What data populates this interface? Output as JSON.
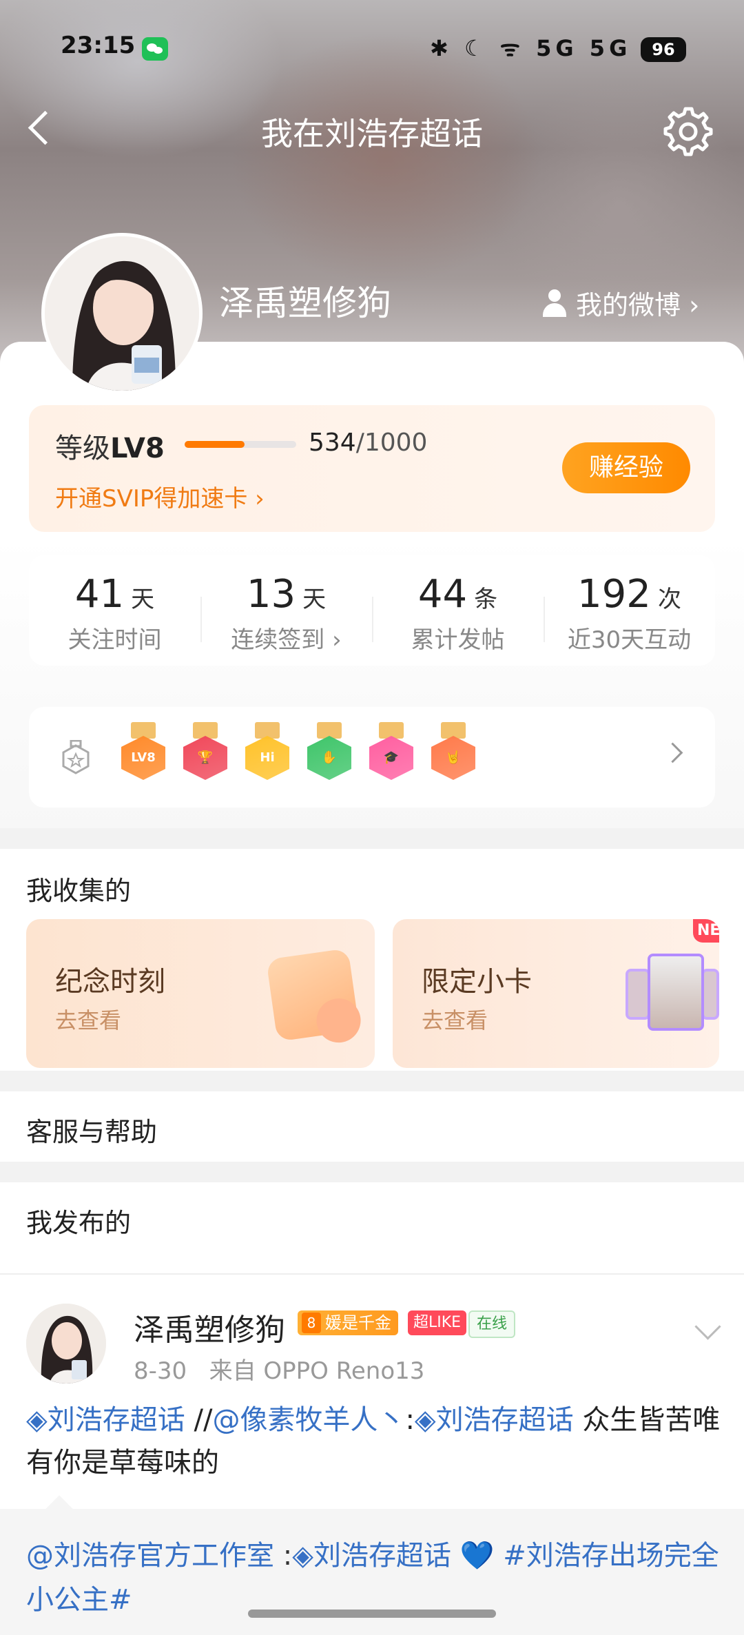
{
  "status_bar": {
    "time": "23:15",
    "battery": "96",
    "signals": "✱ ☾ ᯤ 5G 5G"
  },
  "nav": {
    "title": "我在刘浩存超话"
  },
  "profile": {
    "username": "泽禹塑修狗",
    "my_weibo": "我的微博 ›"
  },
  "level": {
    "label_prefix": "等级",
    "level": "LV8",
    "current": "534",
    "total": "/1000",
    "progress": 0.534,
    "svip_text": "开通SVIP得加速卡 ›",
    "earn_button": "赚经验"
  },
  "stats": [
    {
      "num": "41",
      "unit": "天",
      "label": "关注时间"
    },
    {
      "num": "13",
      "unit": "天",
      "label": "连续签到 ›"
    },
    {
      "num": "44",
      "unit": "条",
      "label": "累计发帖"
    },
    {
      "num": "192",
      "unit": "次",
      "label": "近30天互动"
    }
  ],
  "badges": [
    {
      "name": "lv-badge",
      "color": "#ff8a2a",
      "glyph": "LV8"
    },
    {
      "name": "trophy-badge",
      "color": "#f0485a",
      "glyph": "🏆"
    },
    {
      "name": "hi-badge",
      "color": "#ffc22a",
      "glyph": "Hi"
    },
    {
      "name": "hand-badge",
      "color": "#3fc56a",
      "glyph": "✋"
    },
    {
      "name": "graduate-badge",
      "color": "#ff5fa0",
      "glyph": "🎓"
    },
    {
      "name": "rock-badge",
      "color": "#ff7a4a",
      "glyph": "🤘"
    }
  ],
  "collected": {
    "title": "我收集的",
    "items": [
      {
        "title": "纪念时刻",
        "sub": "去查看"
      },
      {
        "title": "限定小卡",
        "sub": "去查看",
        "tag": "NE"
      }
    ]
  },
  "help": {
    "title": "客服与帮助"
  },
  "posted": {
    "title": "我发布的"
  },
  "post": {
    "author": "泽禹塑修狗",
    "tag_fan": "媛是千金",
    "tag_like": "超LIKE",
    "tag_online": "在线",
    "date": "8-30",
    "source": "来自 OPPO Reno13",
    "link1": "◈刘浩存超话",
    "mid1": " //",
    "mention1": "@像素牧羊人丶",
    "colon1": ":",
    "link2": "◈刘浩存超话",
    "rest": " 众生皆苦唯有你是草莓味的",
    "quote_mention": "@刘浩存官方工作室",
    "quote_colon": " :",
    "quote_link": "◈刘浩存超话",
    "quote_heart": " 💙 ",
    "quote_topic": "#刘浩存出场完全小公主#"
  }
}
